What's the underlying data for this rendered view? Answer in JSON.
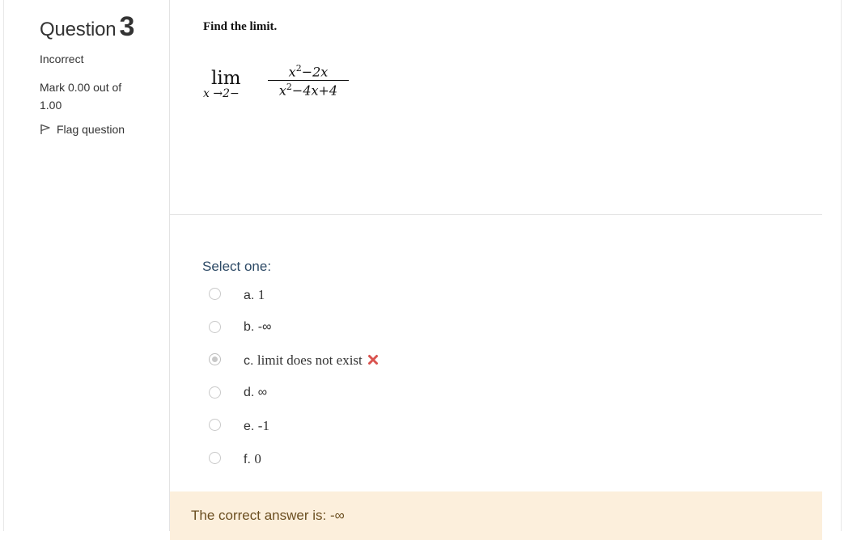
{
  "info": {
    "question_label": "Question",
    "question_number": "3",
    "state": "Incorrect",
    "grade": "Mark 0.00 out of 1.00",
    "flag_label": "Flag question"
  },
  "question": {
    "prompt": "Find the limit.",
    "limit_word": "lim",
    "limit_sub": "x →2−",
    "numerator_a": "x",
    "numerator_exp": "2",
    "numerator_b": "−2x",
    "denominator_a": "x",
    "denominator_exp": "2",
    "denominator_b": "−4x+4"
  },
  "answers": {
    "select_prompt": "Select one:",
    "options": [
      {
        "letter": "a.",
        "text": "1",
        "checked": false
      },
      {
        "letter": "b.",
        "text": "-∞",
        "checked": false
      },
      {
        "letter": "c.",
        "text": "limit does not exist",
        "checked": true,
        "icon": "cross-icon"
      },
      {
        "letter": "d.",
        "text": "∞",
        "checked": false
      },
      {
        "letter": "e.",
        "text": "-1",
        "checked": false
      },
      {
        "letter": "f.",
        "text": "0",
        "checked": false
      }
    ]
  },
  "feedback": {
    "correct_answer": "The correct answer is: -∞"
  },
  "colors": {
    "feedback_bg": "#fcefdc",
    "feedback_text": "#6b4e20",
    "select_prompt": "#2d4a66",
    "incorrect_icon": "#d9534f"
  }
}
